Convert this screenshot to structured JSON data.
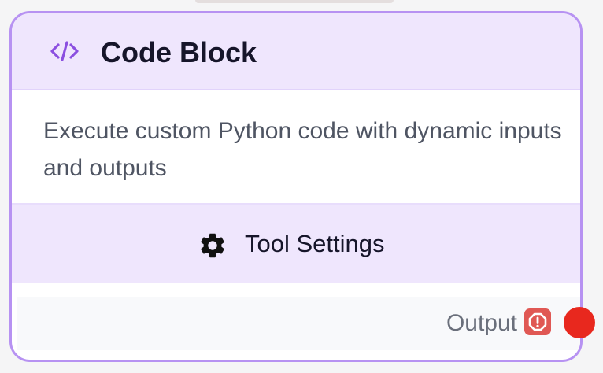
{
  "node": {
    "title": "Code Block",
    "icon": "code-icon",
    "description": "Execute custom Python code with dynamic inputs and outputs",
    "settings_button": {
      "label": "Tool Settings",
      "icon": "gear-icon"
    },
    "output": {
      "label": "Output",
      "status_icon": "warning-icon",
      "handle_color": "#e8281e"
    }
  },
  "colors": {
    "accent_border": "#b792f2",
    "header_bg": "#efe6fd",
    "icon_purple": "#8b4fe0",
    "warning_red": "#e05854"
  }
}
